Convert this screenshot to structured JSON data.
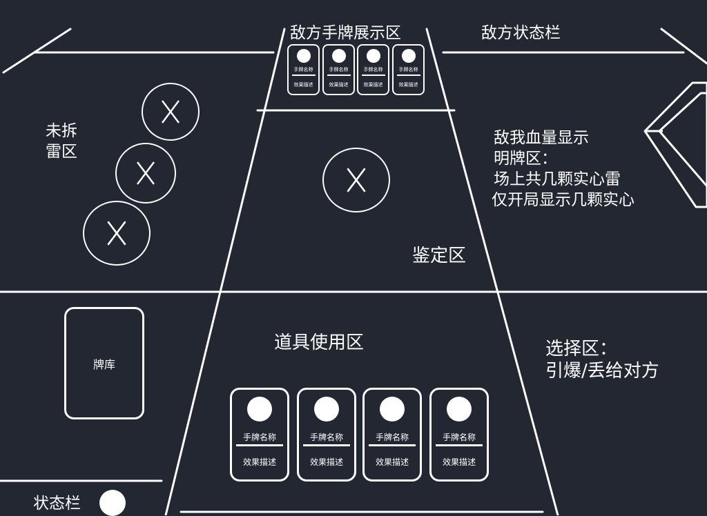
{
  "labels": {
    "enemy_hand_area": "敌方手牌展示区",
    "enemy_status_bar": "敌方状态栏",
    "undefused_mines_line1": "未拆",
    "undefused_mines_line2": "雷区",
    "hp_info_line1": "敌我血量显示",
    "hp_info_line2": "明牌区：",
    "hp_info_line3": "场上共几颗实心雷",
    "hp_info_line4": "仅开局显示几颗实心",
    "identify_area": "鉴定区",
    "item_use_area": "道具使用区",
    "choice_area_line1": "选择区：",
    "choice_area_line2": "引爆/丢给对方",
    "deck": "牌库",
    "status_bar": "状态栏"
  },
  "card_text": {
    "name": "手牌名称",
    "desc": "效果描述"
  },
  "mine_icon": "x-circle-icon",
  "colors": {
    "background": "#222732",
    "line": "#ffffff"
  }
}
